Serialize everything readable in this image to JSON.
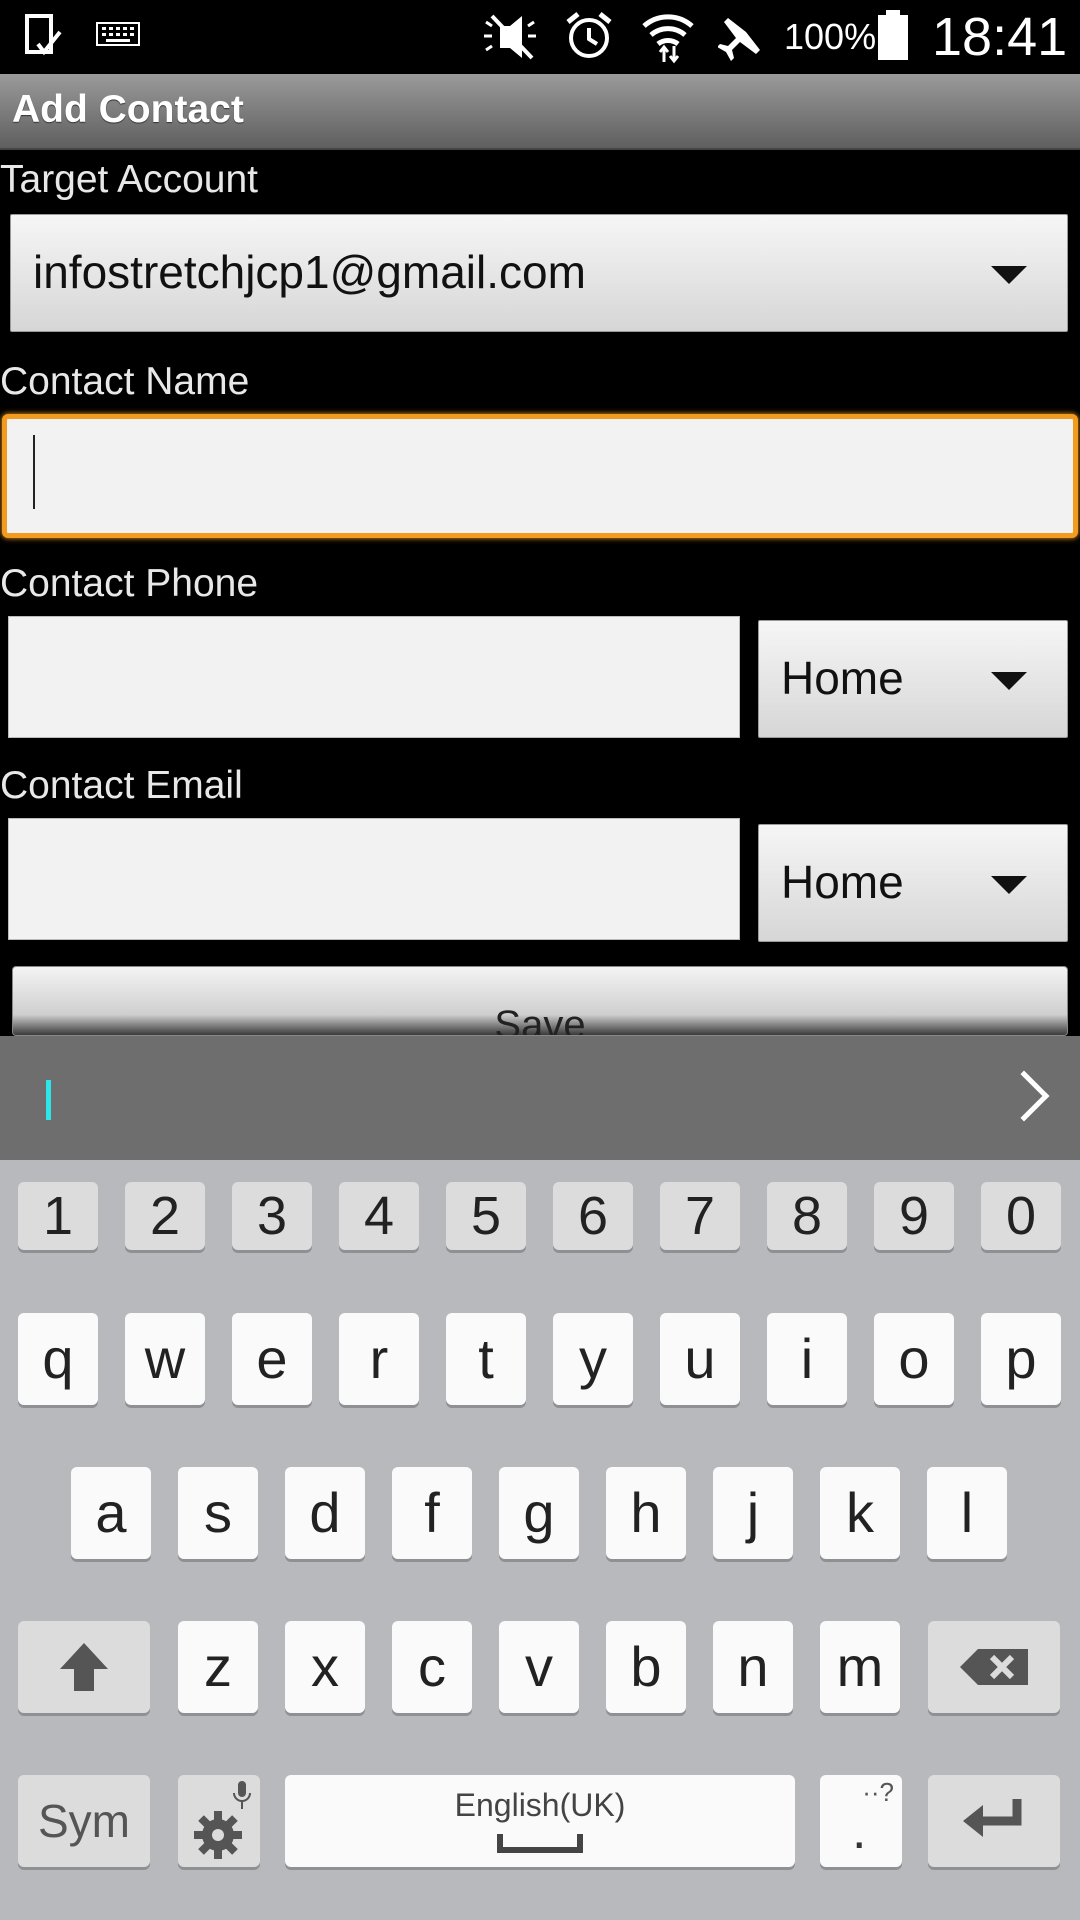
{
  "status_bar": {
    "battery": "100%",
    "time": "18:41",
    "icons": [
      "notification-icon",
      "keyboard-icon",
      "silent-icon",
      "alarm-icon",
      "wifi-icon",
      "airplane-icon",
      "battery-icon"
    ]
  },
  "action_bar": {
    "title": "Add Contact"
  },
  "form": {
    "target_account_label": "Target Account",
    "target_account_value": "infostretchjcp1@gmail.com",
    "contact_name_label": "Contact Name",
    "contact_name_value": "",
    "contact_phone_label": "Contact Phone",
    "phone_type": "Home",
    "contact_email_label": "Contact Email",
    "email_type": "Home",
    "save_label": "Save"
  },
  "keyboard": {
    "numbers": [
      "1",
      "2",
      "3",
      "4",
      "5",
      "6",
      "7",
      "8",
      "9",
      "0"
    ],
    "row1": [
      "q",
      "w",
      "e",
      "r",
      "t",
      "y",
      "u",
      "i",
      "o",
      "p"
    ],
    "row2": [
      "a",
      "s",
      "d",
      "f",
      "g",
      "h",
      "j",
      "k",
      "l"
    ],
    "row3": [
      "z",
      "x",
      "c",
      "v",
      "b",
      "n",
      "m"
    ],
    "sym_label": "Sym",
    "space_label": "English(UK)",
    "period_label": ".",
    "period_alt": "··?",
    "colors": {
      "accent": "#f39b1e",
      "cursor": "#2ee6ea"
    }
  }
}
